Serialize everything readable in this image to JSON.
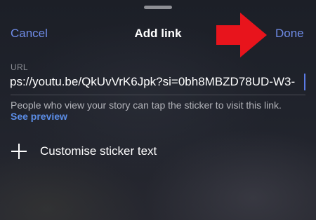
{
  "header": {
    "title": "Add link",
    "cancel_label": "Cancel",
    "done_label": "Done"
  },
  "annotation": {
    "icon": "red-arrow-right-icon",
    "color": "#e8141c"
  },
  "url_field": {
    "label": "URL",
    "value": "ps://youtu.be/QkUvVrK6Jpk?si=0bh8MBZD78UD-W3-"
  },
  "helper": {
    "text": "People who view your story can tap the sticker to visit this link.",
    "preview_label": "See preview"
  },
  "customise": {
    "icon": "plus-icon",
    "label": "Customise sticker text"
  },
  "colors": {
    "accent": "#6f8be6",
    "link": "#5b8de6",
    "background": "#1e2029"
  }
}
